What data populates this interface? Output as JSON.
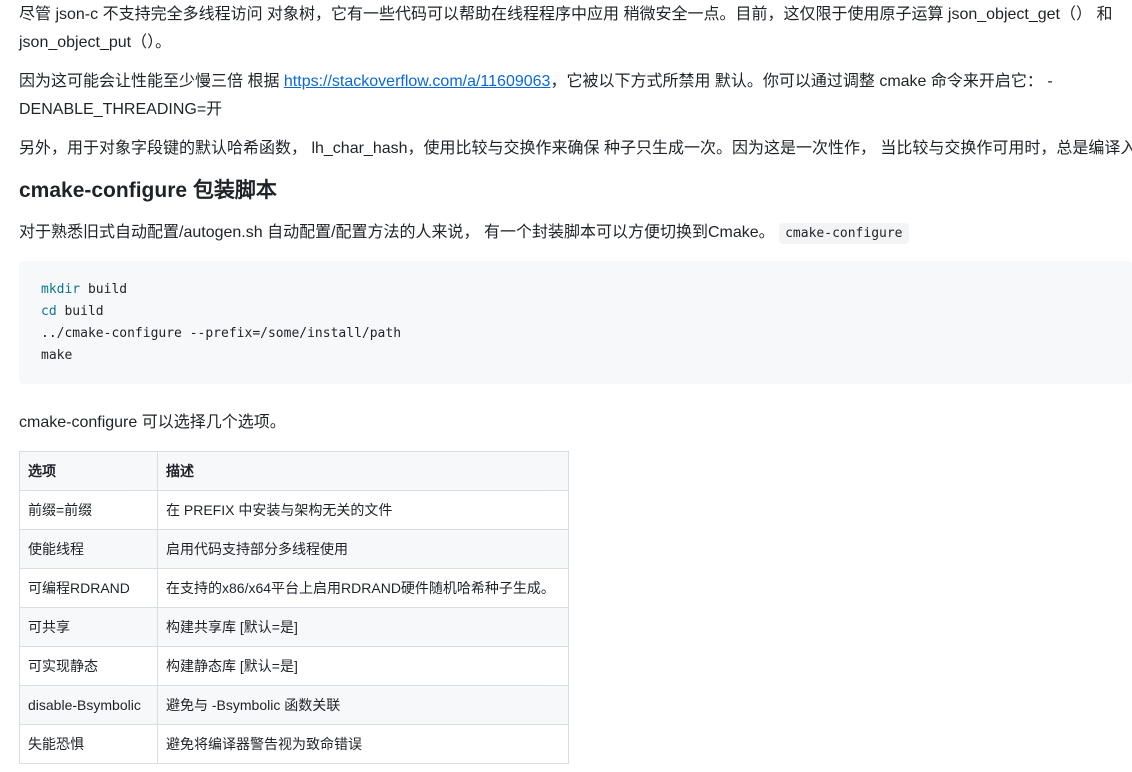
{
  "paragraphs": {
    "p1_line1": "尽管 json-c 不支持完全多线程访问 对象树，它有一些代码可以帮助在线程程序中应用 稍微安全一点。目前，这仅限于使用原子运算 json_object_get（） 和",
    "p1_line2": "json_object_put（）。",
    "p2_before_link": "因为这可能会让性能至少慢三倍 根据 ",
    "p2_link": "https://stackoverflow.com/a/11609063",
    "p2_after_link": "，它被以下方式所禁用 默认。你可以通过调整 cmake 命令来开启它： -",
    "p2_line2": "DENABLE_THREADING=开",
    "p3": "另外，用于对象字段键的默认哈希函数， lh_char_hash，使用比较与交换作来确保 种子只生成一次。因为这是一次性作， 当比较与交换作可用时，总是编译入",
    "p4_text": "对于熟悉旧式自动配置/autogen.sh 自动配置/配置方法的人来说， 有一个封装脚本可以方便切换到Cmake。",
    "p4_code": "cmake-configure",
    "p5": "cmake-configure 可以选择几个选项。"
  },
  "section": {
    "title": "cmake-configure 包装脚本"
  },
  "code_block": {
    "line1_cmd": "mkdir",
    "line1_arg": " build",
    "line2_cmd": "cd",
    "line2_arg": " build",
    "line3": "../cmake-configure --prefix=/some/install/path",
    "line4": "make"
  },
  "options_table": {
    "headers": [
      "选项",
      "描述"
    ],
    "rows": [
      [
        "前缀=前缀",
        "在 PREFIX 中安装与架构无关的文件"
      ],
      [
        "使能线程",
        "启用代码支持部分多线程使用"
      ],
      [
        "可编程RDRAND",
        "在支持的x86/x64平台上启用RDRAND硬件随机哈希种子生成。"
      ],
      [
        "可共享",
        "构建共享库 [默认=是]"
      ],
      [
        "可实现静态",
        "构建静态库 [默认=是]"
      ],
      [
        "disable-Bsymbolic",
        "避免与 -Bsymbolic 函数关联"
      ],
      [
        "失能恐惧",
        "避免将编译器警告视为致命错误"
      ]
    ]
  },
  "colors": {
    "text": "#1f2328",
    "link": "#0969da",
    "code_bg": "#f6f8fa",
    "keyword": "#0e7490",
    "border": "#d8dee4"
  }
}
